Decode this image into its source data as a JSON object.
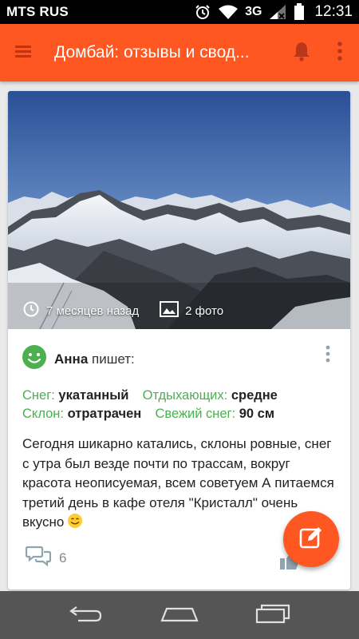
{
  "status_bar": {
    "carrier": "MTS RUS",
    "network": "3G",
    "time": "12:31"
  },
  "app_bar": {
    "title": "Домбай: отзывы и свод...",
    "icons": [
      "menu-icon",
      "bell-icon",
      "overflow-icon"
    ],
    "color": "#ff5722"
  },
  "post": {
    "time_ago": "7 месяцев назад",
    "photos": "2 фото",
    "author": "Анна",
    "author_suffix": " пишет:",
    "conditions": {
      "snow_label": "Снег:",
      "snow_value": "укатанный",
      "crowd_label": "Отдыхающих:",
      "crowd_value": "средне",
      "slope_label": "Склон:",
      "slope_value": "отратрачен",
      "fresh_label": "Свежий снег:",
      "fresh_value": "90 см"
    },
    "text": "Сегодня шикарно катались, склоны ровные, снег с утра был везде почти по трассам, вокруг красота неописуемая, всем советуем   А питаемся третий день в кафе отеля \"Кристалл\" очень вкусно",
    "comments_count": "6",
    "accent_color": "#4caf50"
  },
  "fab": {
    "icon": "edit-icon",
    "color": "#ff5722"
  },
  "nav_bar": {
    "icons": [
      "back-icon",
      "home-icon",
      "recents-icon"
    ]
  }
}
